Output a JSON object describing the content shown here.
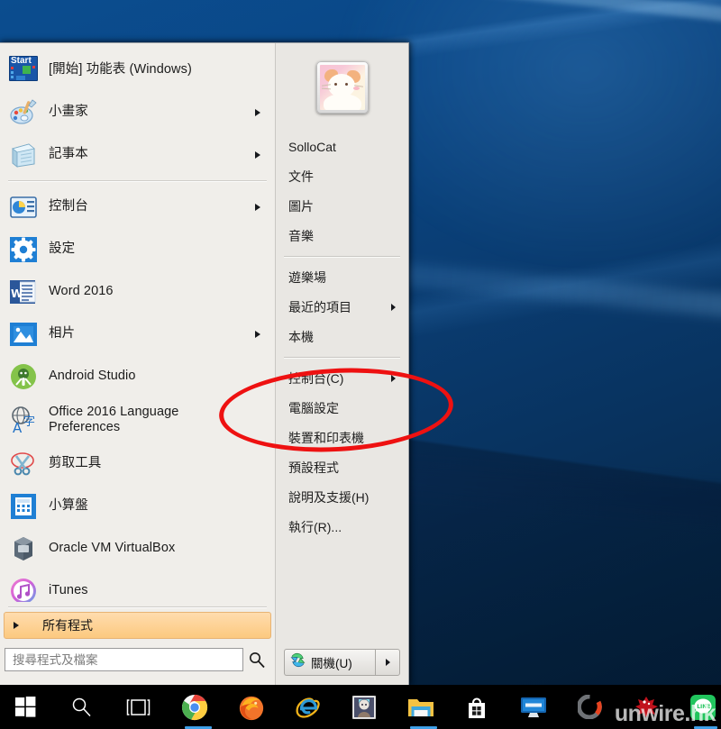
{
  "desktop": {
    "wallpaper_name": "windows-10-blue-wallpaper"
  },
  "start_menu": {
    "programs": [
      {
        "label": "[開始] 功能表 (Windows)",
        "icon": "start-menu-shortcut-icon",
        "arrow": false
      },
      {
        "label": "小畫家",
        "icon": "paint-icon",
        "arrow": true
      },
      {
        "label": "記事本",
        "icon": "notepad-icon",
        "arrow": true
      },
      {
        "label": "控制台",
        "icon": "control-panel-icon",
        "arrow": true
      },
      {
        "label": "設定",
        "icon": "settings-gear-icon",
        "arrow": false
      },
      {
        "label": "Word 2016",
        "icon": "word-icon",
        "arrow": false
      },
      {
        "label": "相片",
        "icon": "photos-icon",
        "arrow": true
      },
      {
        "label": "Android Studio",
        "icon": "android-studio-icon",
        "arrow": false
      },
      {
        "label": "Office 2016 Language\nPreferences",
        "icon": "office-language-icon",
        "arrow": false
      },
      {
        "label": "剪取工具",
        "icon": "snipping-tool-icon",
        "arrow": false
      },
      {
        "label": "小算盤",
        "icon": "calculator-icon",
        "arrow": false
      },
      {
        "label": "Oracle VM VirtualBox",
        "icon": "virtualbox-icon",
        "arrow": false
      },
      {
        "label": "iTunes",
        "icon": "itunes-icon",
        "arrow": false
      }
    ],
    "separator_after_index": [
      2
    ],
    "all_programs": {
      "label": "所有程式",
      "icon": "chevron-right-icon",
      "highlight_color": "#fcc97f"
    },
    "search": {
      "placeholder": "搜尋程式及檔案",
      "value": "",
      "icon": "search-icon"
    },
    "right_panel": {
      "user_name": "SolloCat",
      "avatar_icon": "user-avatar-cat-picture",
      "items": [
        {
          "label": "文件",
          "arrow": false
        },
        {
          "label": "圖片",
          "arrow": false
        },
        {
          "label": "音樂",
          "arrow": false
        },
        {
          "separator": true
        },
        {
          "label": "遊樂場",
          "arrow": false
        },
        {
          "label": "最近的項目",
          "arrow": true
        },
        {
          "label": "本機",
          "arrow": false
        },
        {
          "separator": true
        },
        {
          "label": "控制台(C)",
          "arrow": true
        },
        {
          "label": "電腦設定",
          "arrow": false
        },
        {
          "label": "裝置和印表機",
          "arrow": false
        },
        {
          "label": "預設程式",
          "arrow": false
        },
        {
          "label": "說明及支援(H)",
          "arrow": false
        },
        {
          "label": "執行(R)...",
          "arrow": false
        }
      ],
      "shutdown": {
        "label": "關機(U)",
        "icon": "shutdown-icon",
        "more_icon": "chevron-right-icon"
      }
    }
  },
  "annotation": {
    "type": "red-ellipse",
    "color": "#ee1111",
    "targets": "控制台(C)"
  },
  "taskbar": {
    "items": [
      {
        "name": "start-button",
        "icon": "windows-logo-icon",
        "active": false
      },
      {
        "name": "search-button",
        "icon": "search-icon",
        "active": false
      },
      {
        "name": "task-view-button",
        "icon": "task-view-icon",
        "active": false
      },
      {
        "name": "chrome-button",
        "icon": "chrome-icon",
        "active": true
      },
      {
        "name": "firefox-button",
        "icon": "firefox-icon",
        "active": false
      },
      {
        "name": "internet-explorer-button",
        "icon": "internet-explorer-icon",
        "active": false
      },
      {
        "name": "game-app-button",
        "icon": "anime-game-icon",
        "active": false
      },
      {
        "name": "file-explorer-button",
        "icon": "folder-icon",
        "active": true
      },
      {
        "name": "store-button",
        "icon": "windows-store-icon",
        "active": false
      },
      {
        "name": "soundpeats-button",
        "icon": "monitor-app-icon",
        "active": false
      },
      {
        "name": "adobe-button",
        "icon": "circle-loader-icon",
        "active": false
      },
      {
        "name": "red-app-button",
        "icon": "red-splat-icon",
        "active": false
      },
      {
        "name": "line-button",
        "icon": "line-messenger-icon",
        "active": true
      }
    ],
    "watermark": "unwire.hk"
  }
}
